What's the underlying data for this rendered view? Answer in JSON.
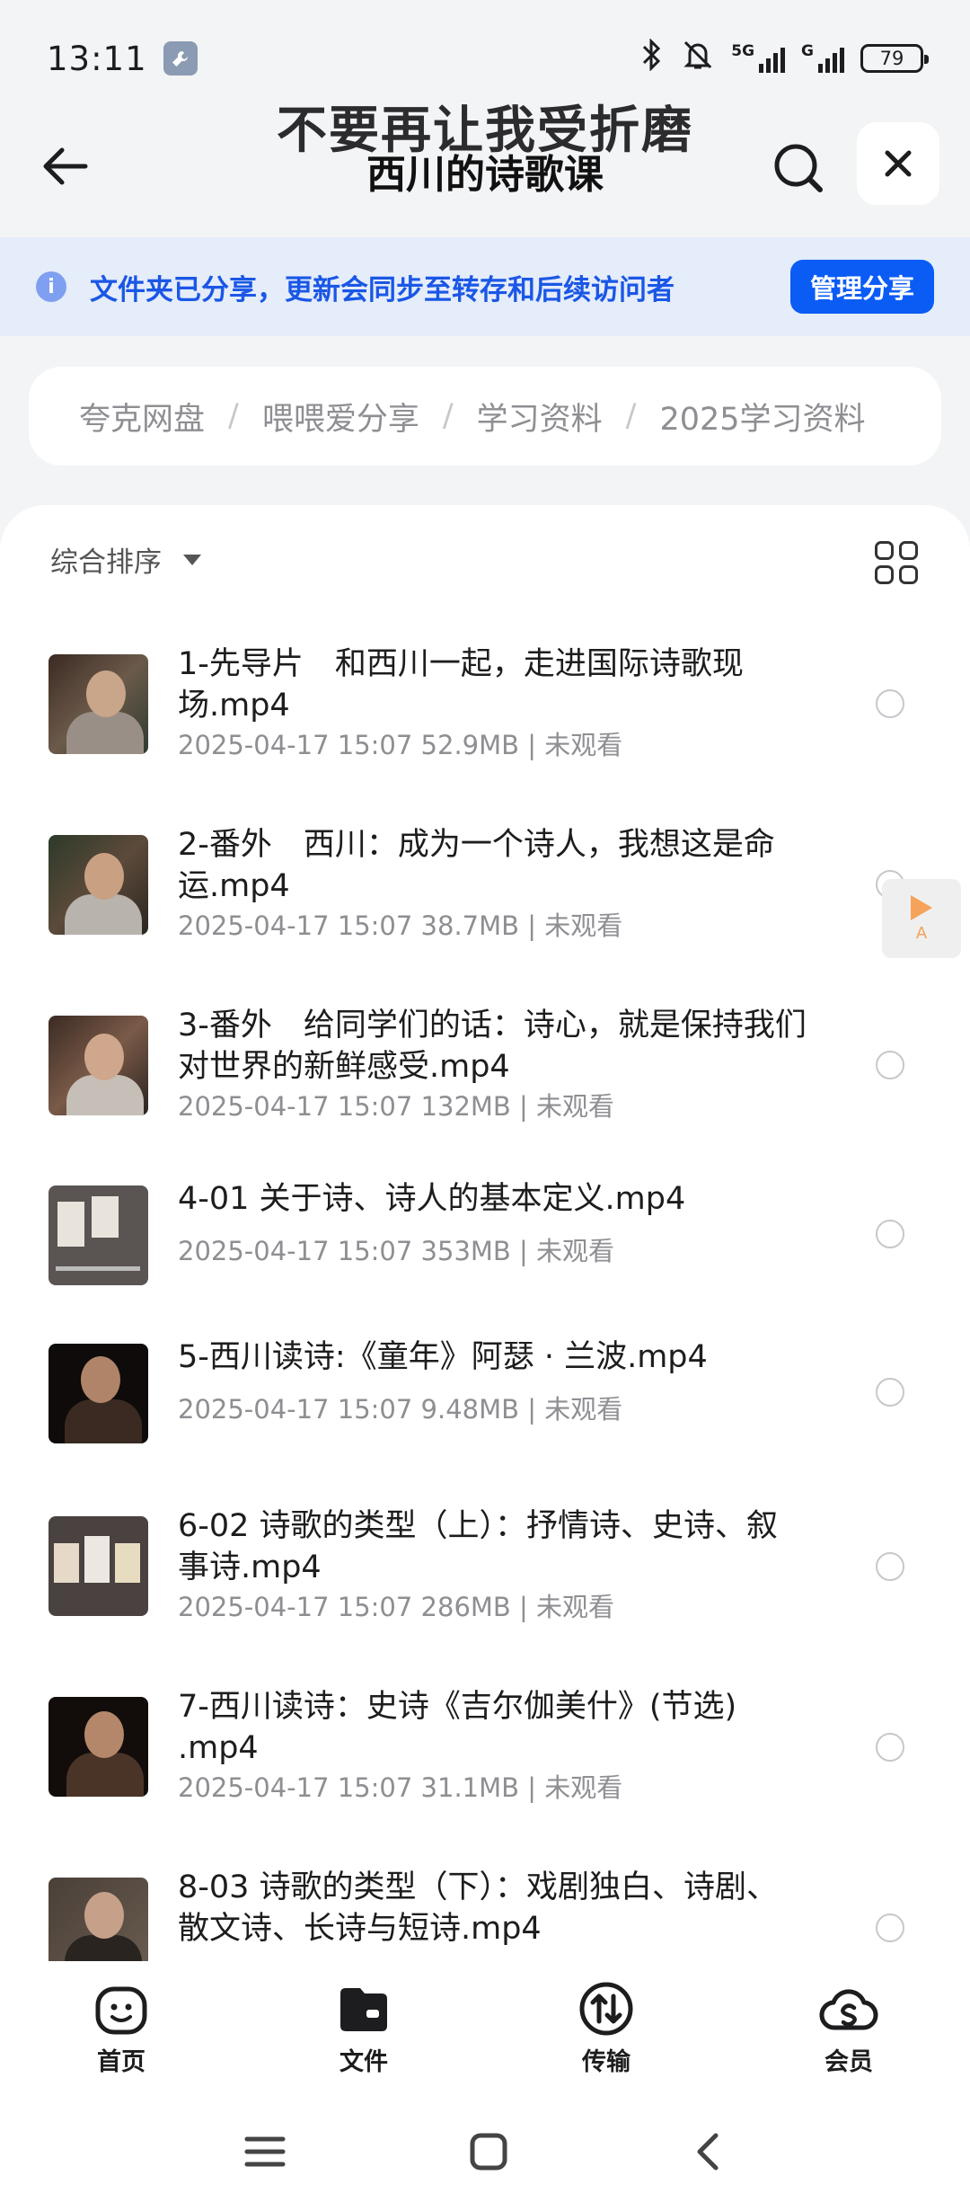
{
  "status_bar": {
    "time": "13:11",
    "network_1": "5G",
    "network_2": "G",
    "battery": "79"
  },
  "header": {
    "title": "不要再让我受折磨",
    "subtitle": "西川的诗歌课"
  },
  "share_banner": {
    "text": "文件夹已分享，更新会同步至转存和后续访问者",
    "button": "管理分享"
  },
  "breadcrumb": [
    "夸克网盘",
    "喂喂爱分享",
    "学习资料",
    "2025学习资料"
  ],
  "sort": {
    "label": "综合排序"
  },
  "files": [
    {
      "name": "1-先导片　和西川一起，走进国际诗歌现场.mp4",
      "date": "2025-04-17 15:07",
      "size": "52.9MB",
      "status": "未观看"
    },
    {
      "name": "2-番外　西川：成为一个诗人，我想这是命运.mp4",
      "date": "2025-04-17 15:07",
      "size": "38.7MB",
      "status": "未观看"
    },
    {
      "name": "3-番外　给同学们的话：诗心，就是保持我们对世界的新鲜感受.mp4",
      "date": "2025-04-17 15:07",
      "size": "132MB",
      "status": "未观看"
    },
    {
      "name": "4-01 关于诗、诗人的基本定义.mp4",
      "date": "2025-04-17 15:07",
      "size": "353MB",
      "status": "未观看"
    },
    {
      "name": "5-西川读诗:《童年》阿瑟 · 兰波.mp4",
      "date": "2025-04-17 15:07",
      "size": "9.48MB",
      "status": "未观看"
    },
    {
      "name": "6-02 诗歌的类型（上）：抒情诗、史诗、叙事诗.mp4",
      "date": "2025-04-17 15:07",
      "size": "286MB",
      "status": "未观看"
    },
    {
      "name": "7-西川读诗：史诗《吉尔伽美什》(节选) .mp4",
      "date": "2025-04-17 15:07",
      "size": "31.1MB",
      "status": "未观看"
    },
    {
      "name": "8-03 诗歌的类型（下）：戏剧独白、诗剧、散文诗、长诗与短诗.mp4",
      "date": "",
      "size": "",
      "status": ""
    }
  ],
  "floating_player": {
    "label": "A"
  },
  "tabs": [
    {
      "label": "首页",
      "icon": "smiley-home-icon"
    },
    {
      "label": "文件",
      "icon": "folder-icon"
    },
    {
      "label": "传输",
      "icon": "transfer-icon"
    },
    {
      "label": "会员",
      "icon": "cloud-member-icon"
    }
  ]
}
